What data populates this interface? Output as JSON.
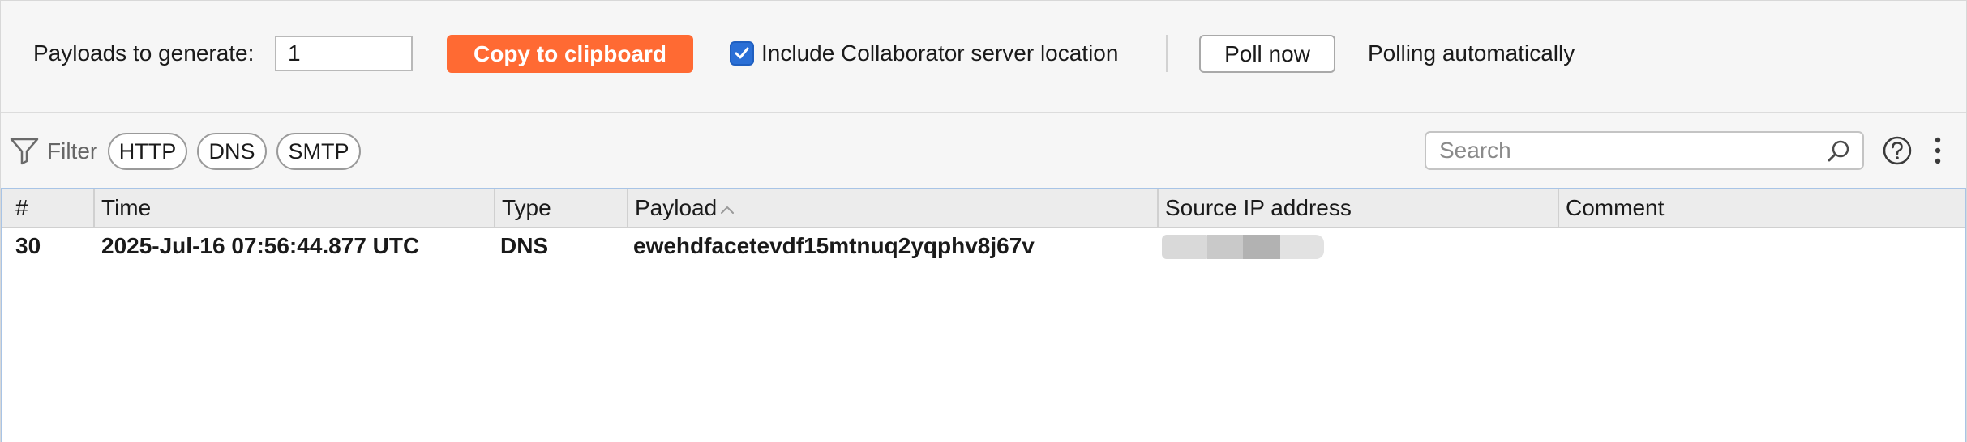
{
  "config": {
    "payloads_label": "Payloads to generate:",
    "payloads_value": "1",
    "copy_button": "Copy to clipboard",
    "include_location_checked": true,
    "include_location_label": "Include Collaborator server location",
    "poll_button": "Poll now",
    "polling_status": "Polling automatically"
  },
  "filter": {
    "label": "Filter",
    "chips": [
      "HTTP",
      "DNS",
      "SMTP"
    ],
    "search_placeholder": "Search"
  },
  "table": {
    "columns": [
      "#",
      "Time",
      "Type",
      "Payload",
      "Source IP address",
      "Comment"
    ],
    "sorted_column": "Payload",
    "sort_direction": "ascending",
    "rows": [
      {
        "num": "30",
        "time": "2025-Jul-16 07:56:44.877 UTC",
        "type": "DNS",
        "payload": "ewehdfacetevdf15mtnuq2yqphv8j67v",
        "source_ip_redacted": true,
        "comment": ""
      }
    ]
  },
  "colors": {
    "accent_button": "#ff6a33",
    "checkbox": "#2a6fd6",
    "table_border": "#a8c4e6"
  },
  "icons": [
    "filter-icon",
    "search-icon",
    "help-icon",
    "more-vertical-icon",
    "checkmark-icon",
    "sort-up-icon"
  ]
}
